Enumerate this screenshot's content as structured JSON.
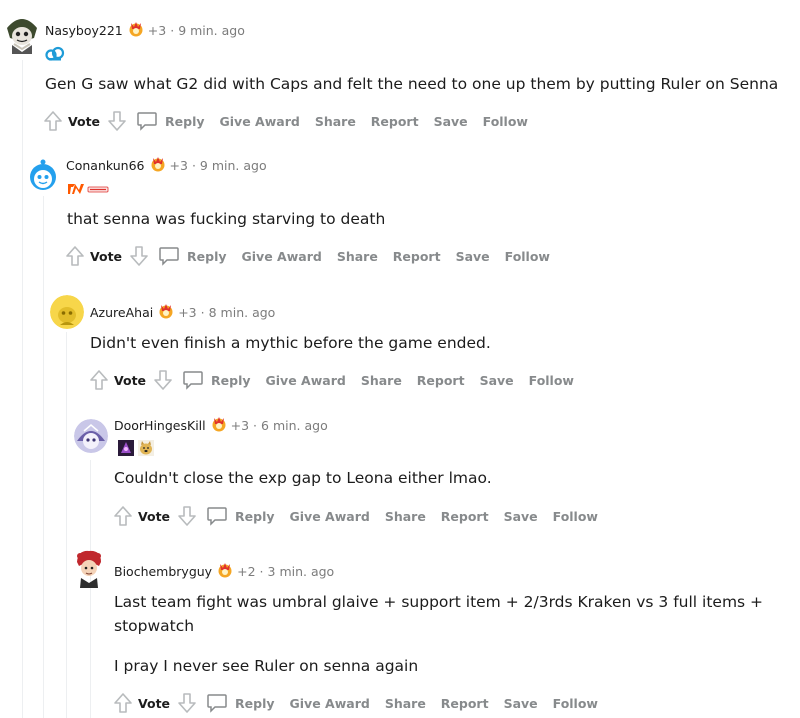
{
  "comments": [
    {
      "username": "Nasyboy221",
      "score": "+3",
      "time": "9 min. ago",
      "body": [
        "Gen G saw what G2 did with Caps and felt the need to one up them by putting Ruler on Senna"
      ]
    },
    {
      "username": "Conankun66",
      "score": "+3",
      "time": "9 min. ago",
      "body": [
        "that senna was fucking starving to death"
      ]
    },
    {
      "username": "AzureAhai",
      "score": "+3",
      "time": "8 min. ago",
      "body": [
        "Didn't even finish a mythic before the game ended."
      ]
    },
    {
      "username": "DoorHingesKill",
      "score": "+3",
      "time": "6 min. ago",
      "body": [
        "Couldn't close the exp gap to Leona either lmao."
      ]
    },
    {
      "username": "Biochembryguy",
      "score": "+2",
      "time": "3 min. ago",
      "body": [
        "Last team fight was umbral glaive + support item + 2/3rds Kraken vs 3 full items +",
        "stopwatch",
        "I pray I never see Ruler on senna again"
      ]
    }
  ],
  "actions": {
    "vote": "Vote",
    "reply": "Reply",
    "give_award": "Give Award",
    "share": "Share",
    "report": "Report",
    "save": "Save",
    "follow": "Follow"
  },
  "separator": "·",
  "colors": {
    "meta_gray": "#7c7c7c",
    "action_gray": "#878a8c",
    "thread_line": "#edeff1",
    "award_gold": "#f5a623",
    "award_red": "#e0322c"
  }
}
